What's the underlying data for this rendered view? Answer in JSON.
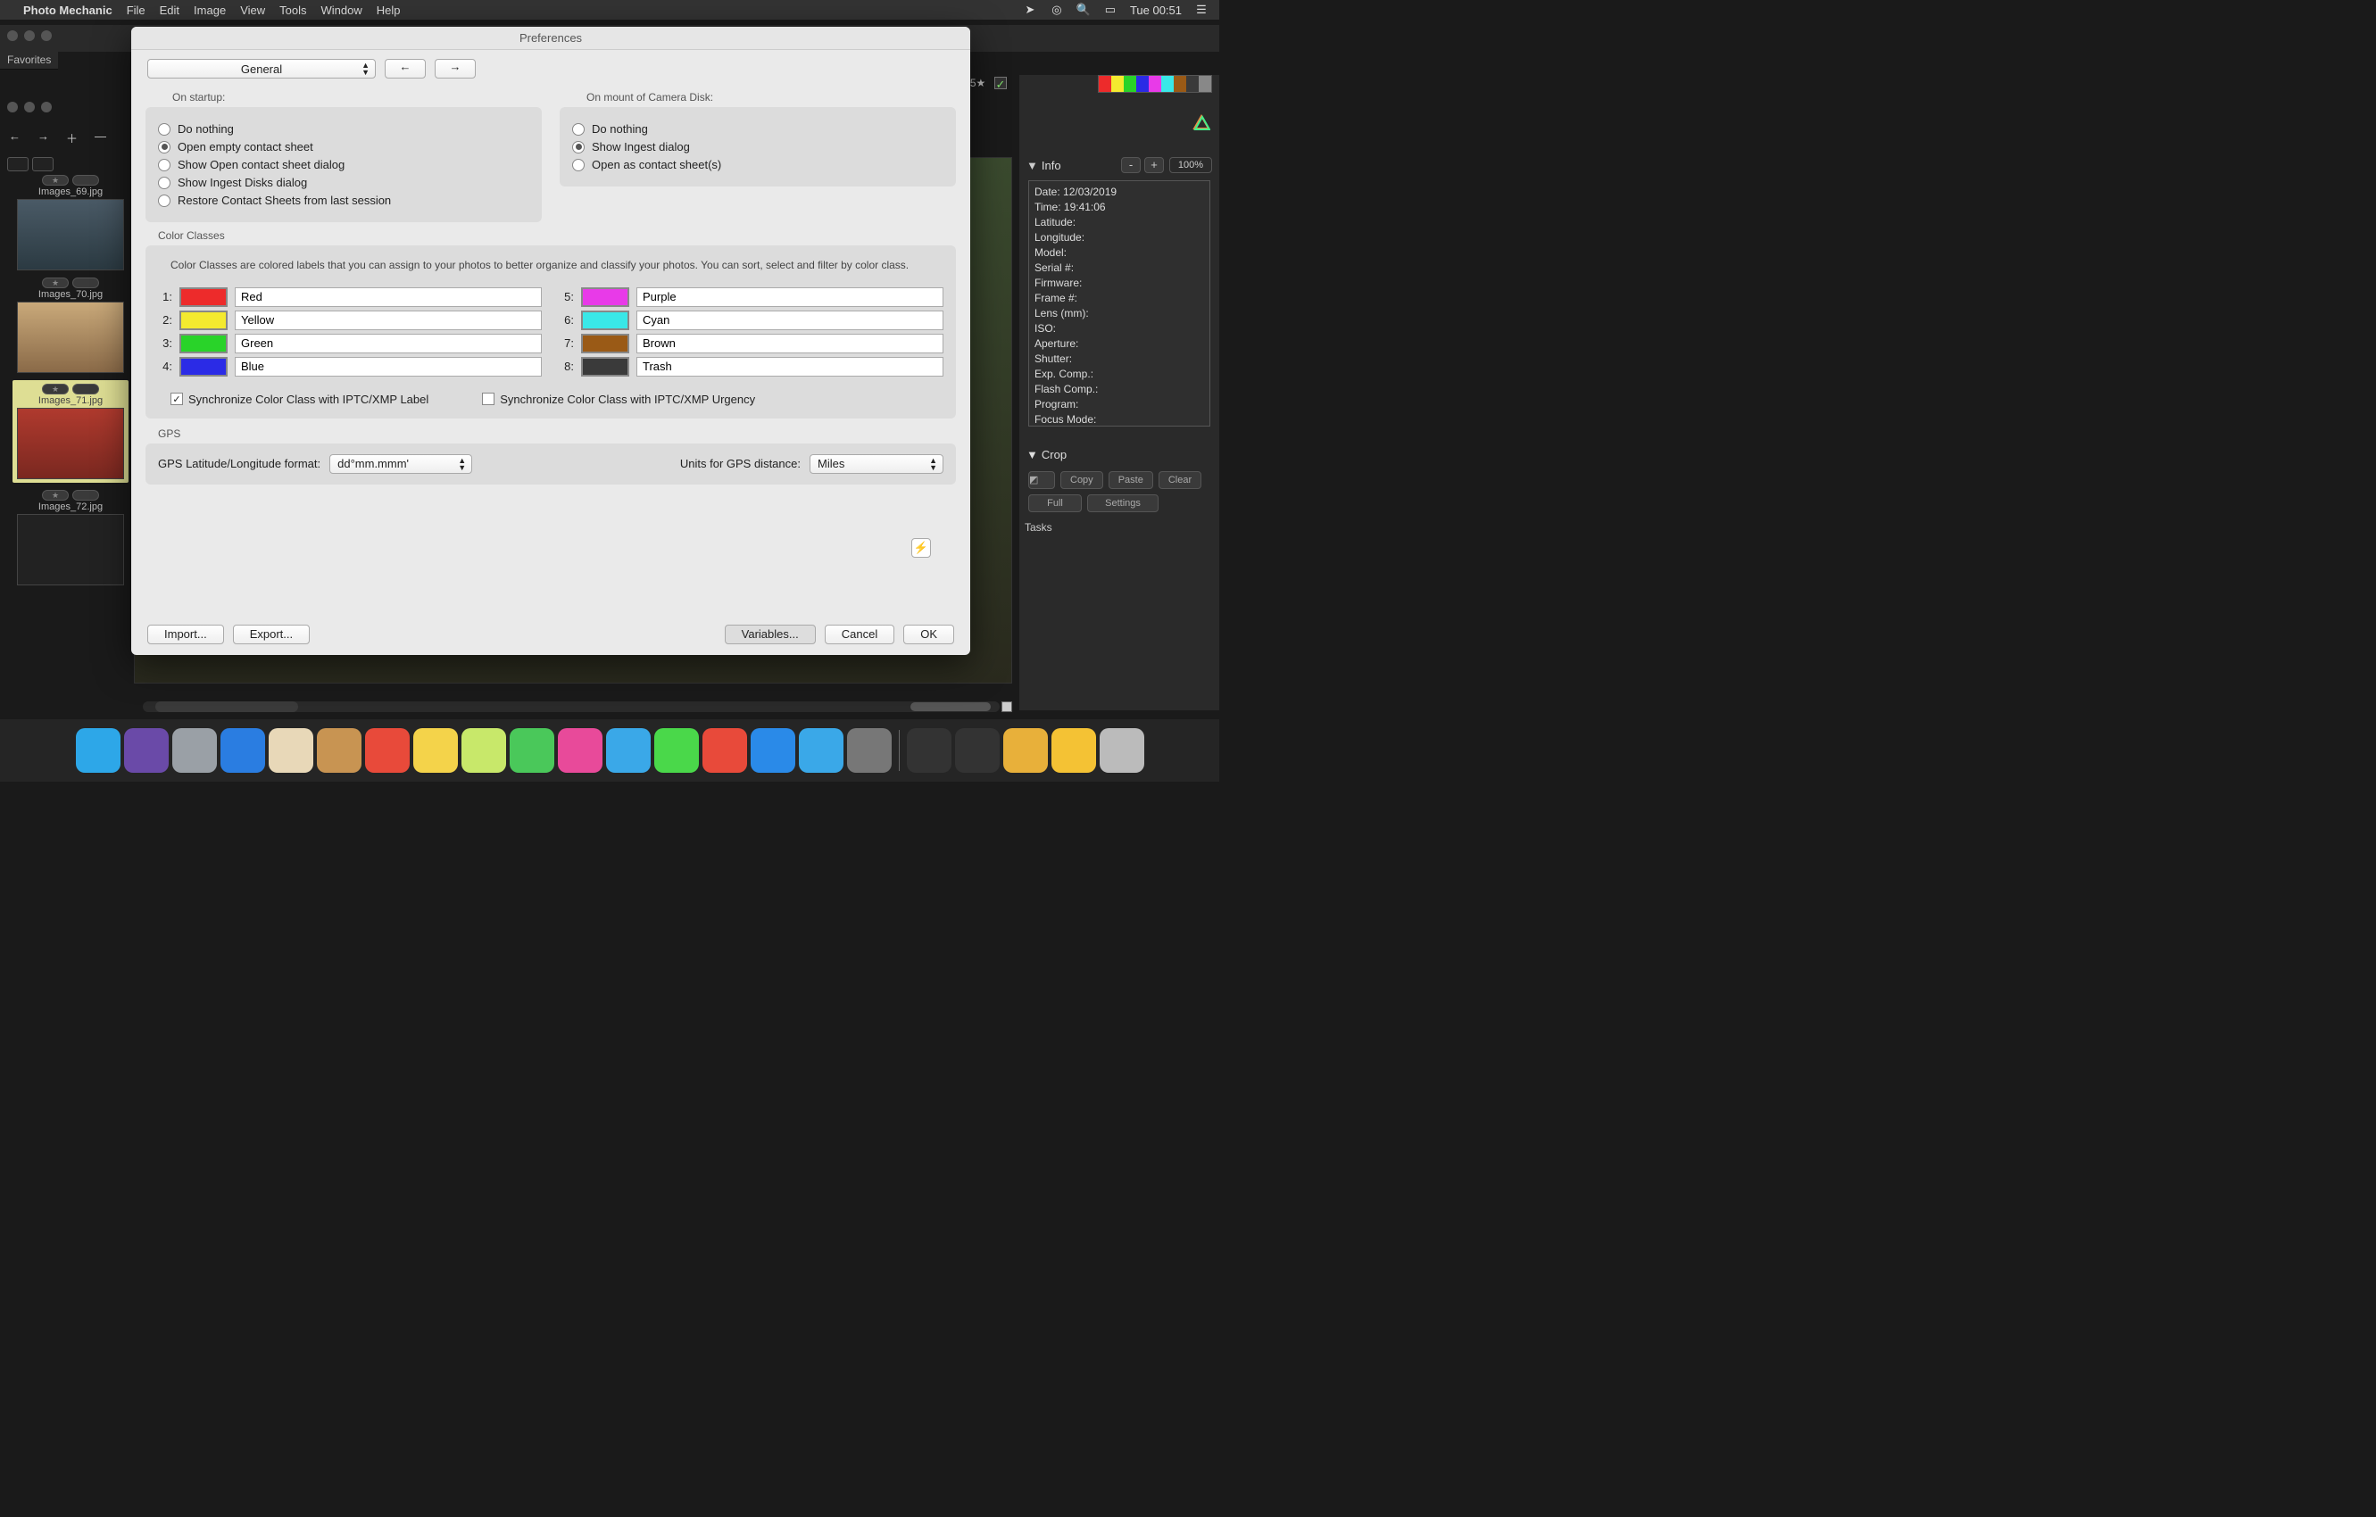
{
  "menubar": {
    "app": "Photo Mechanic",
    "items": [
      "File",
      "Edit",
      "Image",
      "View",
      "Tools",
      "Window",
      "Help"
    ],
    "clock": "Tue 00:51"
  },
  "favorites": "Favorites",
  "dialog": {
    "title": "Preferences",
    "category": "General",
    "startup": {
      "title": "On startup:",
      "opts": [
        "Do nothing",
        "Open empty contact sheet",
        "Show Open contact sheet dialog",
        "Show Ingest Disks dialog",
        "Restore Contact Sheets from last session"
      ],
      "selected": 1
    },
    "mount": {
      "title": "On mount of Camera Disk:",
      "opts": [
        "Do nothing",
        "Show Ingest dialog",
        "Open as contact sheet(s)"
      ],
      "selected": 1
    },
    "cc": {
      "title": "Color Classes",
      "desc": "Color Classes are colored labels that you can assign to your photos to better organize and classify your photos.  You can sort, select and filter by color class.",
      "items": [
        {
          "n": "1",
          "c": "#ed2b2b",
          "name": "Red"
        },
        {
          "n": "2",
          "c": "#f4ea2f",
          "name": "Yellow"
        },
        {
          "n": "3",
          "c": "#29d329",
          "name": "Green"
        },
        {
          "n": "4",
          "c": "#2b2be6",
          "name": "Blue"
        },
        {
          "n": "5",
          "c": "#e83ae8",
          "name": "Purple"
        },
        {
          "n": "6",
          "c": "#39e8e8",
          "name": "Cyan"
        },
        {
          "n": "7",
          "c": "#9a5a16",
          "name": "Brown"
        },
        {
          "n": "8",
          "c": "#3a3a3a",
          "name": "Trash"
        }
      ],
      "sync_label": "Synchronize Color Class with IPTC/XMP Label",
      "sync_urgency": "Synchronize Color Class with IPTC/XMP Urgency"
    },
    "gps": {
      "title": "GPS",
      "fmt_label": "GPS Latitude/Longitude format:",
      "fmt_value": "dd°mm.mmm'",
      "units_label": "Units for GPS distance:",
      "units_value": "Miles"
    },
    "buttons": {
      "import": "Import...",
      "export": "Export...",
      "vars": "Variables...",
      "cancel": "Cancel",
      "ok": "OK"
    }
  },
  "thumbs": [
    {
      "f": "Images_69.jpg",
      "bg": "linear-gradient(#4a5a66,#2b3a42)"
    },
    {
      "f": "Images_70.jpg",
      "bg": "linear-gradient(#c9a97a,#8a6a48)"
    },
    {
      "f": "Images_71.jpg",
      "bg": "linear-gradient(#b03a2e,#7a2820)",
      "sel": true
    },
    {
      "f": "Images_72.jpg",
      "bg": "#222"
    }
  ],
  "info": {
    "header": "Info",
    "zoom": "100%",
    "lines": [
      "Date: 12/03/2019",
      "Time: 19:41:06",
      "Latitude:",
      "Longitude:",
      "Model:",
      "Serial #:",
      "Firmware:",
      "Frame #:",
      "Lens (mm):",
      "ISO:",
      "Aperture:",
      "Shutter:",
      "Exp. Comp.:",
      "Flash Comp.:",
      "Program:",
      "Focus Mode:"
    ]
  },
  "crop": {
    "header": "Crop",
    "btns": [
      "Copy",
      "Paste",
      "Clear",
      "Full",
      "Settings"
    ]
  },
  "tasks": "Tasks",
  "starfilter": "3★4★5★",
  "colorbar": [
    "#ed2b2b",
    "#f4ea2f",
    "#29d329",
    "#2b2be6",
    "#e83ae8",
    "#39e8e8",
    "#9a5a16",
    "#3a3a3a",
    "#888"
  ],
  "dock": [
    "#2da7e8",
    "#6a4aa8",
    "#9aa0a6",
    "#2a7de1",
    "#e8d8b8",
    "#c89452",
    "#e84a3a",
    "#f4d34a",
    "#c8e86a",
    "#4ac85a",
    "#e84a9a",
    "#3aa8e8",
    "#4ad84a",
    "#e84a3a",
    "#2a8ae8",
    "#3aa8e8",
    "#777",
    "#333",
    "#333",
    "#e8b03a",
    "#f4c234",
    "#bbb"
  ]
}
